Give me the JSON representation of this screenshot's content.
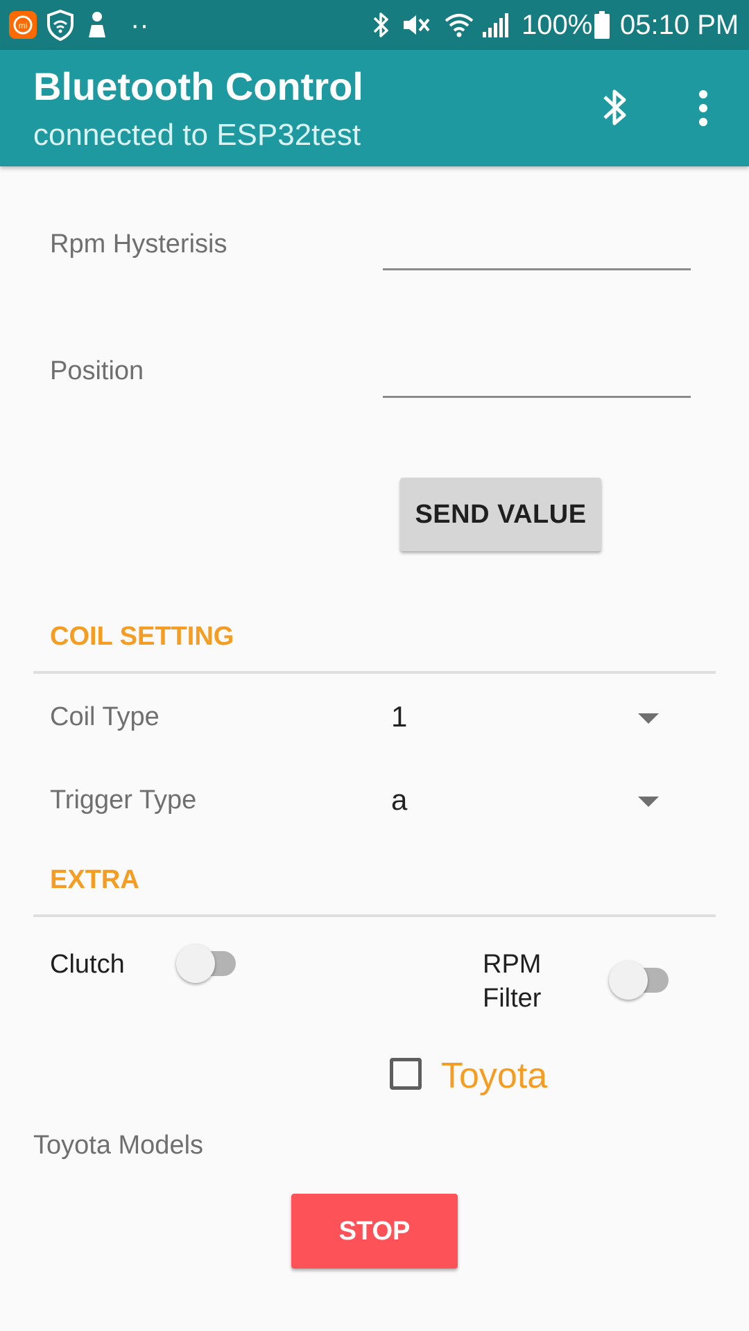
{
  "status_bar": {
    "battery": "100%",
    "time": "05:10 PM",
    "dots": "··",
    "icons": [
      "mi-app-icon",
      "shield-wifi-icon",
      "download-icon",
      "bluetooth-icon",
      "mute-vibrate-icon",
      "wifi-icon",
      "signal-icon",
      "battery-icon"
    ]
  },
  "app_bar": {
    "title": "Bluetooth Control",
    "subtitle": "connected to ESP32test",
    "actions": [
      "bluetooth-icon",
      "more-vert-icon"
    ]
  },
  "form": {
    "rpm_hysteresis_label": "Rpm Hysterisis",
    "rpm_hysteresis_value": "",
    "position_label": "Position",
    "position_value": "",
    "send_button": "SEND VALUE"
  },
  "coil_setting": {
    "header": "COIL SETTING",
    "coil_type_label": "Coil Type",
    "coil_type_value": "1",
    "trigger_type_label": "Trigger Type",
    "trigger_type_value": "a"
  },
  "extra": {
    "header": "EXTRA",
    "clutch_label": "Clutch",
    "clutch_on": false,
    "rpm_filter_label_line1": "RPM",
    "rpm_filter_label_line2": "Filter",
    "rpm_filter_on": false,
    "toyota_label": "Toyota",
    "toyota_checked": false,
    "toyota_models_label": "Toyota Models",
    "stop_button": "STOP"
  },
  "colors": {
    "status_bar": "#167c80",
    "app_bar": "#1e999f",
    "accent": "#f59d22",
    "stop": "#fe5259",
    "background": "#fafafa"
  }
}
